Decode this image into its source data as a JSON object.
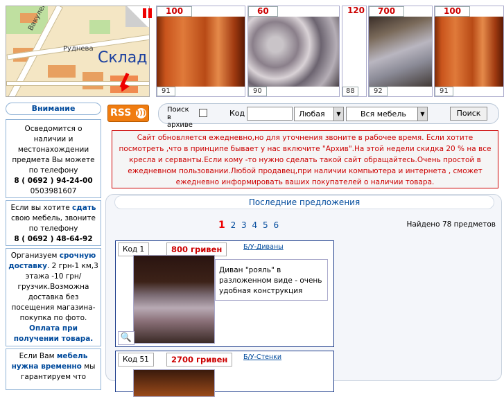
{
  "map": {
    "street1": "Вакуленчука",
    "street2": "Руднева",
    "warehouse": "Склад"
  },
  "thumbs": [
    {
      "price": "100",
      "code": "91"
    },
    {
      "price": "60",
      "code": "90"
    },
    {
      "price": "120",
      "code": "88"
    },
    {
      "price": "700",
      "code": "92"
    },
    {
      "price": "100",
      "code": "91"
    }
  ],
  "sidebar": {
    "title": "Внимание",
    "box1": {
      "text": "Осведомится о наличии и местонахождении предмета Вы можете по телефону",
      "phone1": "8 ( 0692 ) 94-24-00",
      "phone2": "0503981607"
    },
    "box2": {
      "pre": "Если вы хотите",
      "bold": "сдать",
      "post": "свою мебель, звоните по телефону",
      "phone": "8 ( 0692 ) 48-64-92"
    },
    "box3": {
      "pre": "Организуем",
      "bold": "срочную доставку",
      "post": ". 2 грн-1 км,3 этажа -10 грн/грузчик.Возможна доставка без посещения магазина- покупка по фото.",
      "bold2": "Оплата при получении товара."
    },
    "box4": {
      "pre": "Если Вам",
      "bold": "мебель нужна временно",
      "post": "мы гарантируем что"
    }
  },
  "toolbar": {
    "rss": "RSS",
    "archive_label": "Поиск в архиве",
    "code_label": "Код",
    "code_value": "",
    "any_select": "Любая",
    "category_select": "Вся мебель",
    "search_button": "Поиск"
  },
  "notice": "Сайт обновляется ежедневно,но для уточнения звоните в рабочее время. Если хотите посмотреть ,что в принципе бывает у нас включите \"Архив\".На этой недели скидка 20 % на все кресла и серванты.Если кому -то нужно сделать такой сайт обращайтесь.Очень простой в ежедневном пользовании.Любой продавец,при наличии компьютера и интернета , сможет ежедневно информировать ваших покупателей о наличии товара.",
  "main": {
    "heading": "Последние предложения",
    "pages": [
      "1",
      "2",
      "3",
      "4",
      "5",
      "6"
    ],
    "found": "Найдено 78 предметов",
    "listings": [
      {
        "code": "Код 1",
        "price": "800 гривен",
        "category": "Б/У-Диваны",
        "description": "Диван \"рояль\" в разложенном виде - очень удобная конструкция"
      },
      {
        "code": "Код 51",
        "price": "2700 гривен",
        "category": "Б/У-Стенки",
        "description": ""
      }
    ]
  }
}
